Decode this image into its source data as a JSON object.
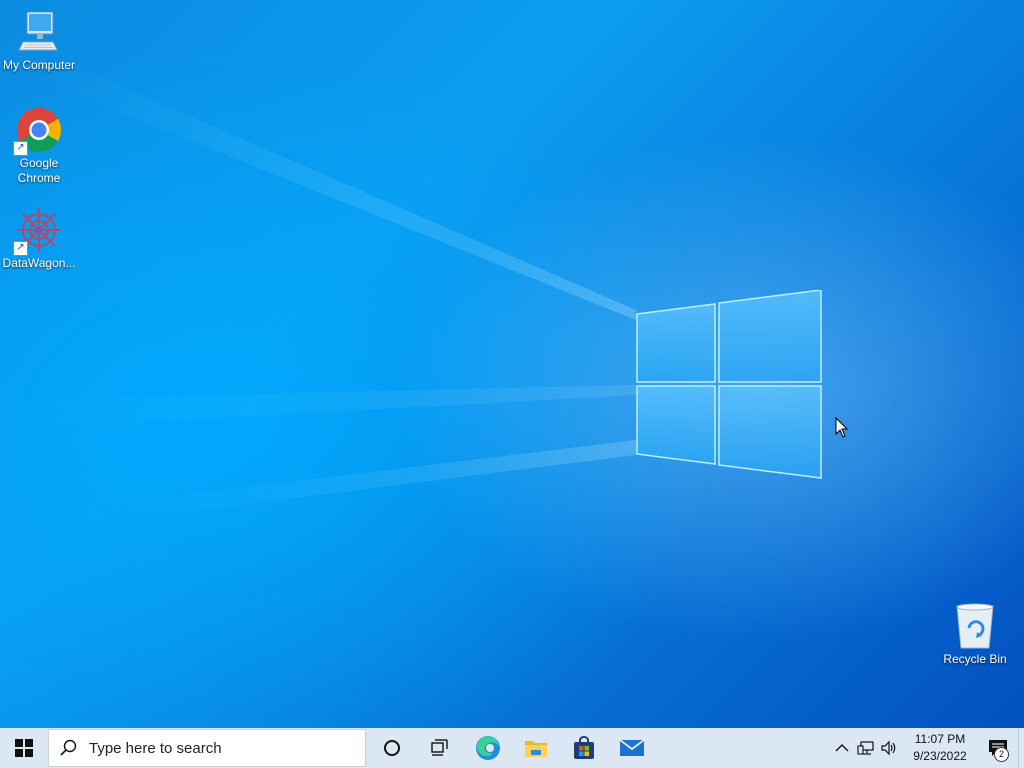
{
  "desktop": {
    "icons": [
      {
        "label": "My Computer",
        "icon": "computer-icon"
      },
      {
        "label": "Google\nChrome",
        "icon": "chrome-icon"
      },
      {
        "label": "DataWagon...",
        "icon": "datawagon-icon"
      },
      {
        "label": "Recycle Bin",
        "icon": "recycle-bin-icon"
      }
    ]
  },
  "taskbar": {
    "search_placeholder": "Type here to search",
    "pinned": [
      {
        "icon": "cortana-icon"
      },
      {
        "icon": "task-view-icon"
      },
      {
        "icon": "edge-icon"
      },
      {
        "icon": "file-explorer-icon"
      },
      {
        "icon": "store-icon"
      },
      {
        "icon": "mail-icon"
      }
    ],
    "clock": {
      "time": "11:07 PM",
      "date": "9/23/2022"
    },
    "notification_count": "2"
  },
  "colors": {
    "taskbar": "#dbe7f3",
    "accent": "#0078d7"
  }
}
